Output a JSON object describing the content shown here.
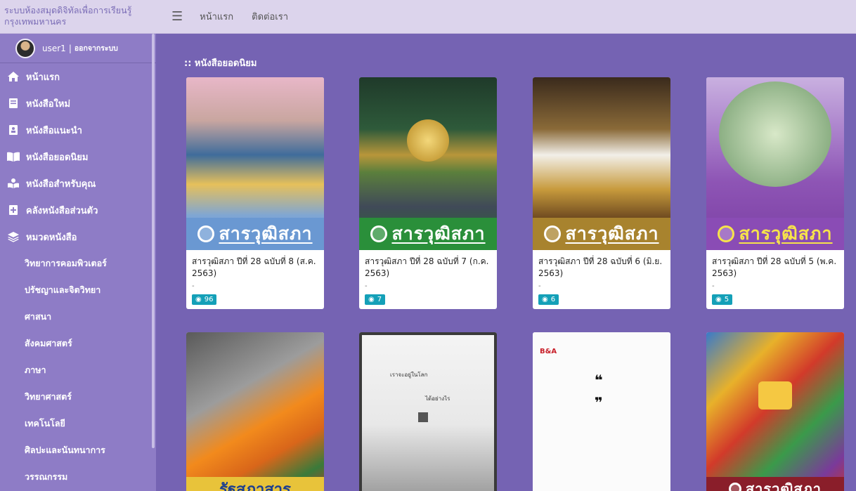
{
  "site": {
    "title": "ระบบห้องสมุดดิจิทัลเพื่อการเรียนรู้กรุงเทพมหานคร"
  },
  "user": {
    "name": "user1",
    "separator": "|",
    "logout": "ออกจากระบบ"
  },
  "topnav": {
    "home": "หน้าแรก",
    "contact": "ติดต่อเรา"
  },
  "sidebar": {
    "items": [
      {
        "label": "หน้าแรก",
        "icon": "home-icon"
      },
      {
        "label": "หนังสือใหม่",
        "icon": "book-new-icon"
      },
      {
        "label": "หนังสือแนะนำ",
        "icon": "book-recommend-icon"
      },
      {
        "label": "หนังสือยอดนิยม",
        "icon": "open-book-icon"
      },
      {
        "label": "หนังสือสำหรับคุณ",
        "icon": "reader-icon"
      },
      {
        "label": "คลังหนังสือส่วนตัว",
        "icon": "plus-box-icon"
      },
      {
        "label": "หมวดหนังสือ",
        "icon": "layers-icon"
      }
    ],
    "categories": [
      "วิทยาการคอมพิวเตอร์",
      "ปรัชญาและจิตวิทยา",
      "ศาสนา",
      "สังคมศาสตร์",
      "ภาษา",
      "วิทยาศาสตร์",
      "เทคโนโลยี",
      "ศิลปะและนันทนาการ",
      "วรรณกรรม"
    ]
  },
  "main": {
    "section_title": ":: หนังสือยอดนิยม",
    "books": [
      {
        "title": "สารวุฒิสภา ปีที่ 28 ฉบับที่ 8 (ส.ค. 2563)",
        "dash": "-",
        "views": "96",
        "cover_text": "สารวุฒิสภา"
      },
      {
        "title": "สารวุฒิสภา ปีที่ 28 ฉบับที่ 7 (ก.ค. 2563)",
        "dash": "-",
        "views": "7",
        "cover_text": "สารวุฒิสภา"
      },
      {
        "title": "สารวุฒิสภา ปีที่ 28 ฉบับที่ 6 (มิ.ย. 2563)",
        "dash": "-",
        "views": "6",
        "cover_text": "สารวุฒิสภา"
      },
      {
        "title": "สารวุฒิสภา ปีที่ 28 ฉบับที่ 5 (พ.ค. 2563)",
        "dash": "-",
        "views": "5",
        "cover_text": "สารวุฒิสภา"
      }
    ],
    "cover_texts": {
      "c5": "รัฐสภาสาร",
      "c6_line1": "เราจะอยู่ในโลก",
      "c6_line2": "ได้อย่างไร",
      "c7_logo": "B&A",
      "c8": "สารวุฒิสภา"
    }
  },
  "colors": {
    "sidebar": "#8e7cc6",
    "main": "#7563b3",
    "header": "#dcd4ec",
    "badge": "#14a0b8"
  }
}
